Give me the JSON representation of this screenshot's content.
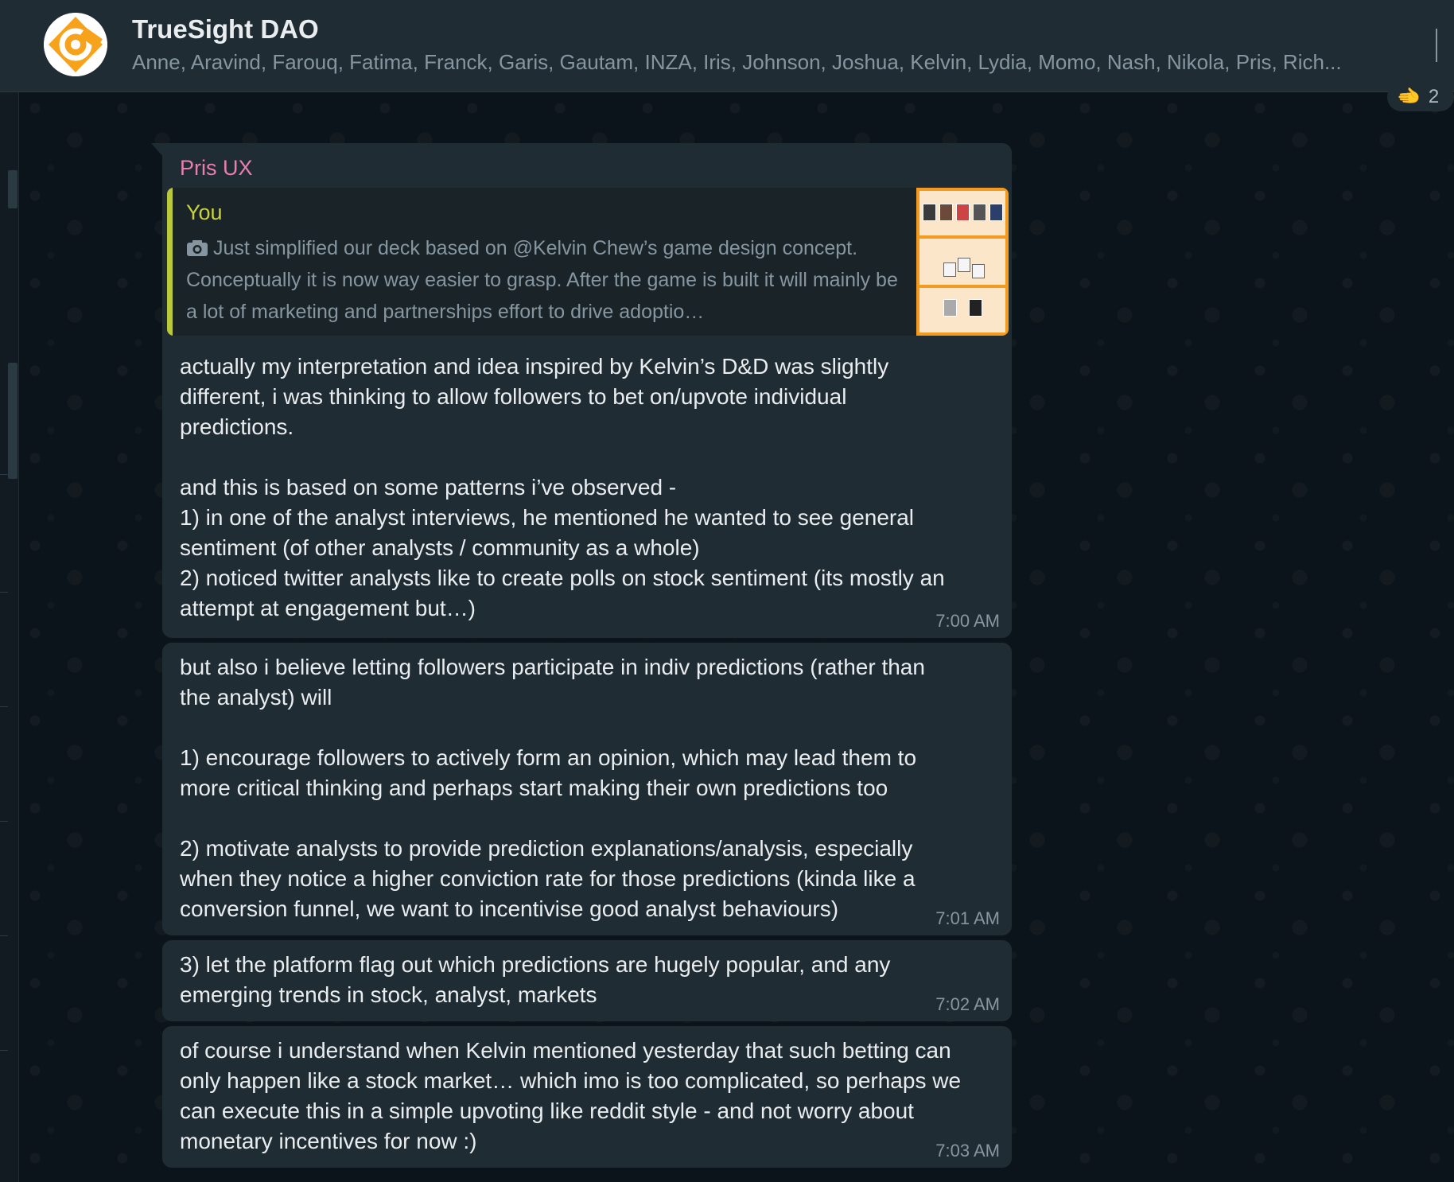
{
  "header": {
    "title": "TrueSight DAO",
    "members": "Anne, Aravind, Farouq, Fatima, Franck, Garis, Gautam, INZA, Iris, Johnson, Joshua, Kelvin, Lydia, Momo, Nash, Nikola, Pris, Rich..."
  },
  "reaction": {
    "emoji": "🫲",
    "count": "2"
  },
  "colors": {
    "bubble_bg": "#202c33",
    "sender_name": "#e87fb0",
    "quote_sender": "#c9d339",
    "quote_bar": "#b9c93a",
    "text_primary": "#e9edef",
    "text_secondary": "#8696a0"
  },
  "messages": [
    {
      "sender": "Pris UX",
      "quote": {
        "sender": "You",
        "icon": "camera-icon",
        "text": "Just simplified our deck based on @Kelvin  Chew’s game design concept. Conceptually it is now way easier to grasp. After the game is built it will mainly be a lot of marketing and partnerships effort to drive adoptio…"
      },
      "text": "actually my interpretation and idea inspired by Kelvin’s D&D was slightly\ndifferent, i was thinking to allow followers to bet on/upvote individual\npredictions.\n\nand this is based on some patterns i’ve observed -\n1) in one of the analyst interviews, he mentioned he wanted to see general\nsentiment (of other analysts / community as a whole)\n2) noticed twitter analysts like to create polls on stock sentiment (its mostly an\nattempt at engagement but…)",
      "time": "7:00 AM"
    },
    {
      "text": "but also i believe letting followers participate in indiv predictions (rather than\nthe analyst) will\n\n1) encourage followers to actively form an opinion, which may lead them to\nmore critical thinking and perhaps start making their own predictions too\n\n2) motivate analysts to provide prediction explanations/analysis, especially\nwhen they notice a higher conviction rate for those predictions (kinda like a\nconversion funnel, we want to incentivise good analyst behaviours)",
      "time": "7:01 AM"
    },
    {
      "text": "3) let the platform flag out which predictions are hugely popular, and any\nemerging trends in stock, analyst, markets",
      "time": "7:02 AM"
    },
    {
      "text": "of course i understand when Kelvin mentioned yesterday that such betting can\nonly happen like a stock market… which imo is too complicated, so perhaps we\ncan execute this in a simple upvoting like reddit style - and not worry about\nmonetary incentives for now :)",
      "time": "7:03 AM"
    }
  ]
}
